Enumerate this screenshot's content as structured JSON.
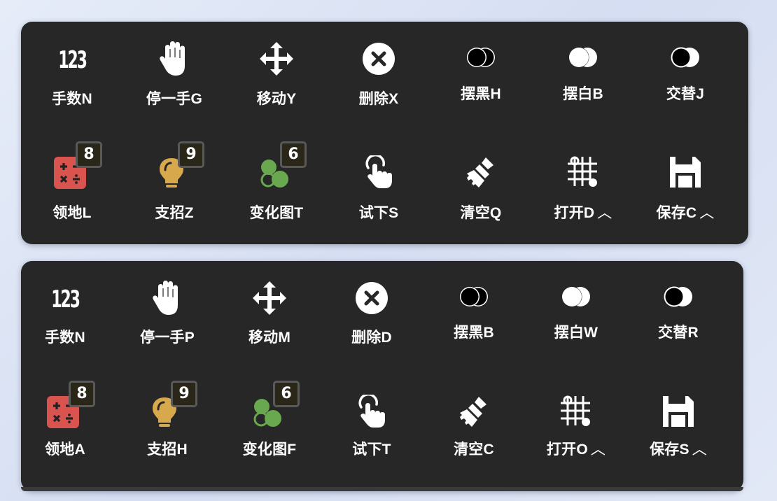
{
  "panels": [
    {
      "tools": [
        {
          "label": "手数N",
          "icon": "move-number-icon",
          "icon_text": "123"
        },
        {
          "label": "停一手G",
          "icon": "hand-icon"
        },
        {
          "label": "移动Y",
          "icon": "move-arrows-icon"
        },
        {
          "label": "删除X",
          "icon": "delete-circle-icon"
        },
        {
          "label": "摆黑H",
          "icon": "black-stone-icon"
        },
        {
          "label": "摆白B",
          "icon": "white-stone-icon"
        },
        {
          "label": "交替J",
          "icon": "alternate-stone-icon"
        },
        {
          "label": "领地L",
          "icon": "calculator-icon",
          "badge": "8"
        },
        {
          "label": "支招Z",
          "icon": "lightbulb-icon",
          "badge": "9"
        },
        {
          "label": "变化图T",
          "icon": "variation-stones-icon",
          "badge": "6"
        },
        {
          "label": "试下S",
          "icon": "tap-hand-icon"
        },
        {
          "label": "清空Q",
          "icon": "broom-icon"
        },
        {
          "label": "打开D",
          "icon": "board-grid-icon",
          "caret": "︿"
        },
        {
          "label": "保存C",
          "icon": "save-icon",
          "caret": "︿"
        }
      ]
    },
    {
      "tools": [
        {
          "label": "手数N",
          "icon": "move-number-icon",
          "icon_text": "123"
        },
        {
          "label": "停一手P",
          "icon": "hand-icon"
        },
        {
          "label": "移动M",
          "icon": "move-arrows-icon"
        },
        {
          "label": "删除D",
          "icon": "delete-circle-icon"
        },
        {
          "label": "摆黑B",
          "icon": "black-stone-icon"
        },
        {
          "label": "摆白W",
          "icon": "white-stone-icon"
        },
        {
          "label": "交替R",
          "icon": "alternate-stone-icon"
        },
        {
          "label": "领地A",
          "icon": "calculator-icon",
          "badge": "8"
        },
        {
          "label": "支招H",
          "icon": "lightbulb-icon",
          "badge": "9"
        },
        {
          "label": "变化图F",
          "icon": "variation-stones-icon",
          "badge": "6"
        },
        {
          "label": "试下T",
          "icon": "tap-hand-icon"
        },
        {
          "label": "清空C",
          "icon": "broom-icon"
        },
        {
          "label": "打开O",
          "icon": "board-grid-icon",
          "caret": "︿"
        },
        {
          "label": "保存S",
          "icon": "save-icon",
          "caret": "︿"
        }
      ]
    }
  ],
  "colors": {
    "panel_bg": "#272727",
    "calculator": "#d9534f",
    "lightbulb": "#d8a84c",
    "variation": "#6aa84f",
    "badge_bg": "#2a2719",
    "badge_border": "#595959"
  }
}
